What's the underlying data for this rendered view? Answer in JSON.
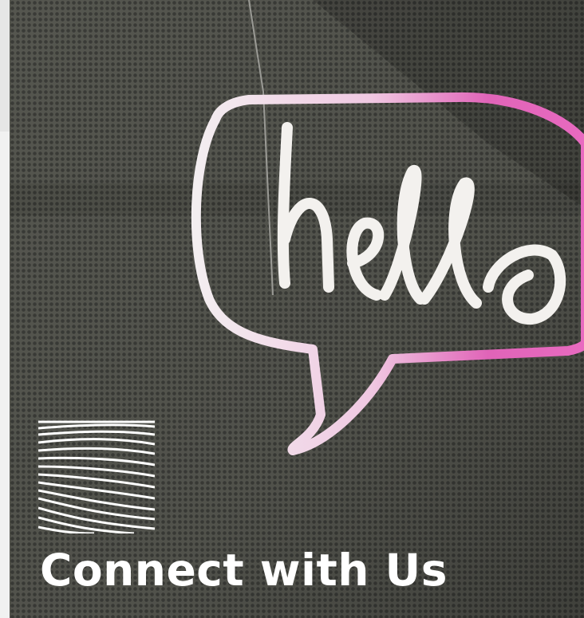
{
  "hero": {
    "title": "Connect with Us",
    "neon_sign_text": "hello",
    "logo_icon": "wavy-lines-logo-icon"
  },
  "colors": {
    "background": "#4d4e4b",
    "neon_white": "#f3f1ee",
    "neon_pink": "#e064b8",
    "title_text": "#ffffff"
  }
}
